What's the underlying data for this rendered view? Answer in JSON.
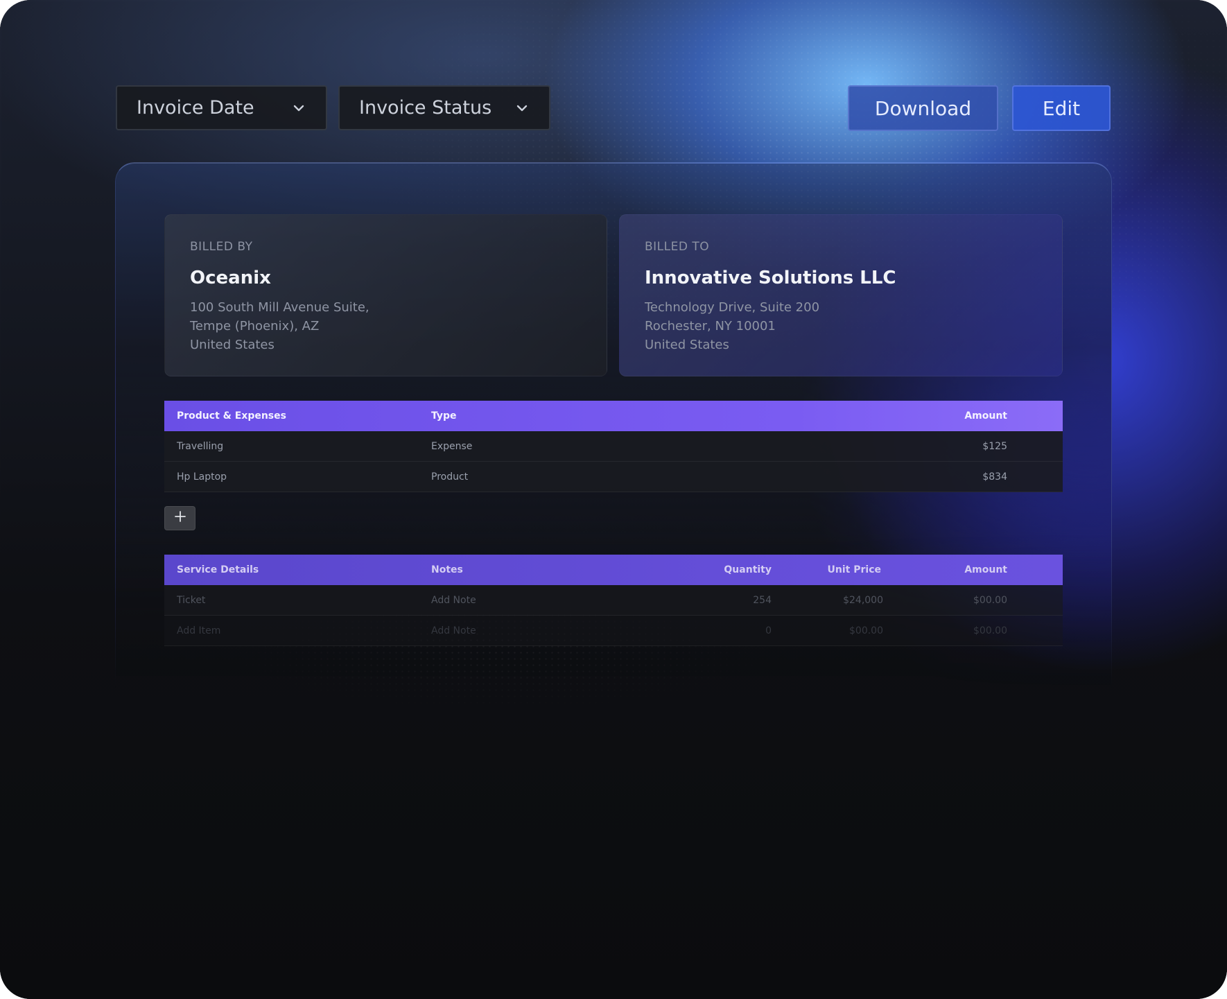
{
  "toolbar": {
    "invoice_date_label": "Invoice Date",
    "invoice_status_label": "Invoice Status",
    "download_label": "Download",
    "edit_label": "Edit"
  },
  "billed_by": {
    "label": "BILLED BY",
    "name": "Oceanix",
    "address_lines": [
      "100 South Mill Avenue Suite,",
      "Tempe (Phoenix), AZ",
      "United States"
    ]
  },
  "billed_to": {
    "label": "BILLED TO",
    "name": "Innovative Solutions LLC",
    "address_lines": [
      "Technology Drive, Suite 200",
      "Rochester, NY 10001",
      "United States"
    ]
  },
  "products_table": {
    "headers": [
      "Product & Expenses",
      "Type",
      "Amount"
    ],
    "rows": [
      [
        "Travelling",
        "Expense",
        "$125"
      ],
      [
        "Hp Laptop",
        "Product",
        "$834"
      ]
    ]
  },
  "add_row_icon": "plus-icon",
  "services_table": {
    "headers": [
      "Service Details",
      "Notes",
      "Quantity",
      "Unit Price",
      "Amount"
    ],
    "rows": [
      [
        "Ticket",
        "Add Note",
        "254",
        "$24,000",
        "$00.00"
      ],
      [
        "Add Item",
        "Add Note",
        "0",
        "$00.00",
        "$00.00"
      ]
    ]
  },
  "colors": {
    "header_purple": "#7a5cf2",
    "accent_blue": "#2c56d2",
    "background": "#0b0c0e"
  }
}
